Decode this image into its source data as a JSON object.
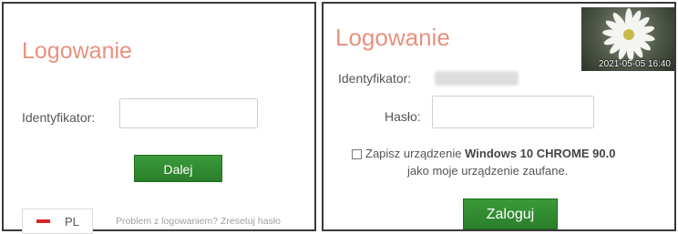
{
  "left_panel": {
    "title": "Logowanie",
    "identifier_label": "Identyfikator:",
    "identifier_value": "",
    "next_button": "Dalej",
    "language": {
      "code": "PL",
      "flag_color": "#d7262b"
    },
    "help_link": "Problem z logowaniem? Zresetuj hasło"
  },
  "right_panel": {
    "title": "Logowanie",
    "photo_timestamp": "2021-05-05 16:40",
    "identifier_label": "Identyfikator:",
    "identifier_value": "",
    "password_label": "Hasło:",
    "password_value": "",
    "trust_checkbox": {
      "checked": false,
      "text_prefix": "Zapisz urządzenie ",
      "device_name": "Windows 10 CHROME 90.0",
      "text_line2": "jako moje urządzenie zaufane."
    },
    "login_button": "Zaloguj"
  },
  "colors": {
    "title": "#e8917e",
    "button": "#2e8b2e",
    "border": "#3a3a3a",
    "help_text": "#a0a0a0"
  }
}
